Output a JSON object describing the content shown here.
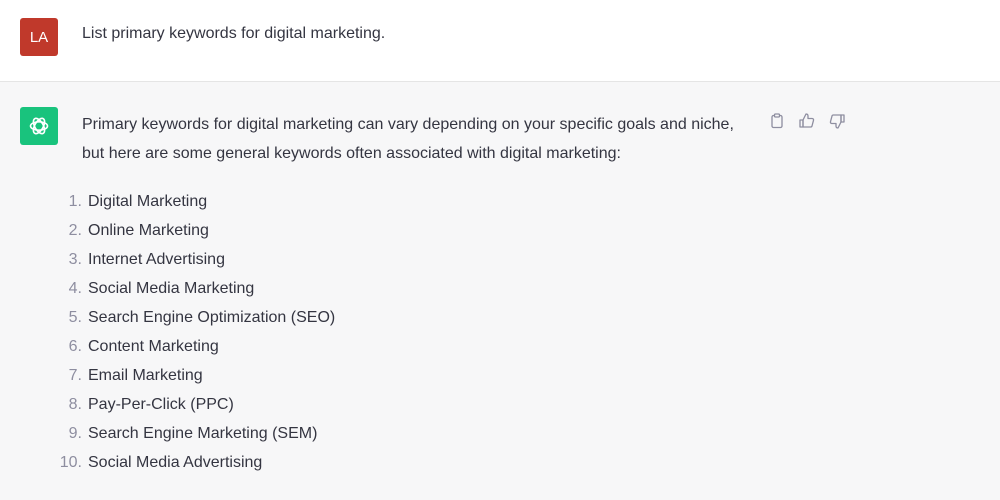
{
  "colors": {
    "user_avatar_bg": "#c0392b",
    "assistant_avatar_bg": "#19c37d",
    "icon_gray": "#8e8ea0"
  },
  "user": {
    "avatar_initials": "LA",
    "message": "List primary keywords for digital marketing."
  },
  "assistant": {
    "avatar_icon": "openai-logo-icon",
    "intro_line1": "Primary keywords for digital marketing can vary depending on your specific goals and niche,",
    "intro_line2": "but here are some general keywords often associated with digital marketing:",
    "actions": [
      "copy-icon",
      "thumbs-up-icon",
      "thumbs-down-icon"
    ],
    "keywords": [
      {
        "num": "1.",
        "text": "Digital Marketing"
      },
      {
        "num": "2.",
        "text": "Online Marketing"
      },
      {
        "num": "3.",
        "text": "Internet Advertising"
      },
      {
        "num": "4.",
        "text": "Social Media Marketing"
      },
      {
        "num": "5.",
        "text": "Search Engine Optimization (SEO)"
      },
      {
        "num": "6.",
        "text": "Content Marketing"
      },
      {
        "num": "7.",
        "text": "Email Marketing"
      },
      {
        "num": "8.",
        "text": "Pay-Per-Click (PPC)"
      },
      {
        "num": "9.",
        "text": "Search Engine Marketing (SEM)"
      },
      {
        "num": "10.",
        "text": "Social Media Advertising"
      }
    ]
  }
}
